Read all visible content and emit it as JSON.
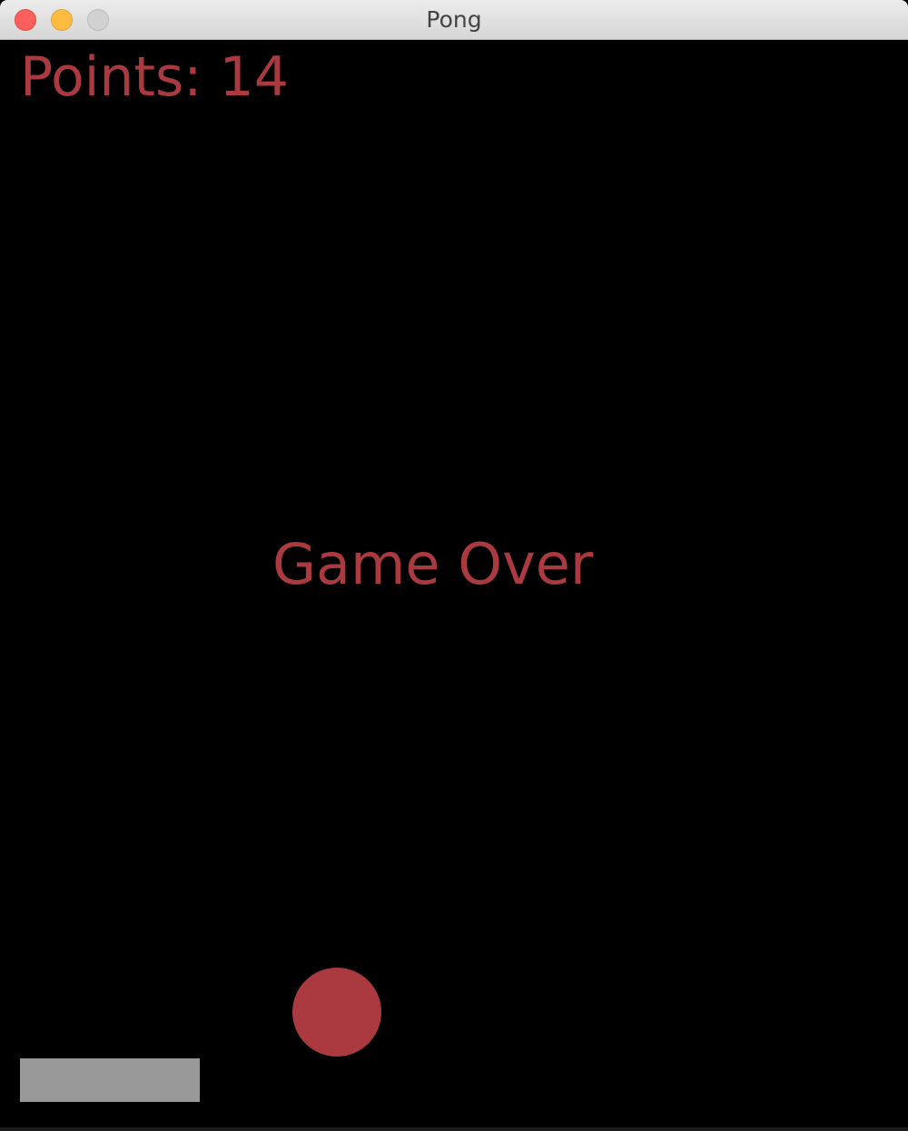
{
  "window": {
    "title": "Pong"
  },
  "hud": {
    "points_text": "Points: 14"
  },
  "status": {
    "message": "Game Over"
  },
  "icons": {
    "close": "close-icon",
    "minimize": "minimize-icon",
    "zoom": "zoom-icon"
  },
  "colors": {
    "text": "#aa3a3f",
    "ball": "#aa3a3f",
    "paddle": "#999999",
    "background": "#000000"
  }
}
